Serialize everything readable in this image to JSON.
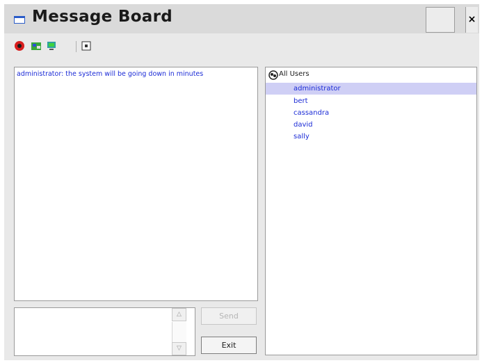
{
  "window": {
    "title": "Message Board",
    "close_label": "×"
  },
  "toolbar": {
    "icons": [
      "record-icon",
      "users-icon",
      "computer-icon",
      "stop-icon"
    ]
  },
  "messages": [
    "administrator: the system will be going down in minutes"
  ],
  "users_tree": {
    "root_label": "All Users",
    "items": [
      {
        "label": "administrator",
        "selected": true
      },
      {
        "label": "bert",
        "selected": false
      },
      {
        "label": "cassandra",
        "selected": false
      },
      {
        "label": "david",
        "selected": false
      },
      {
        "label": "sally",
        "selected": false
      }
    ]
  },
  "compose": {
    "value": ""
  },
  "buttons": {
    "send_label": "Send",
    "exit_label": "Exit"
  },
  "colors": {
    "message_text": "#1b2bd6",
    "selection": "#cfcff5",
    "window_bg": "#e9e9e9"
  }
}
